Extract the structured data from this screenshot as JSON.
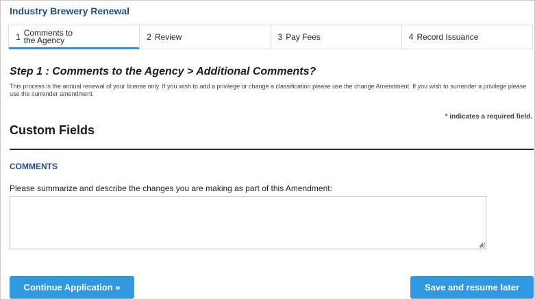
{
  "record": {
    "title": "Industry Brewery Renewal"
  },
  "steps": [
    {
      "num": "1",
      "label": "Comments to the Agency",
      "active": true
    },
    {
      "num": "2",
      "label": "Review",
      "active": false
    },
    {
      "num": "3",
      "label": "Pay Fees",
      "active": false
    },
    {
      "num": "4",
      "label": "Record Issuance",
      "active": false
    }
  ],
  "page": {
    "heading": "Step 1 : Comments to the Agency > Additional Comments?",
    "description": "This process is the annual renewal of your license only.  If you wish to add a privilege or change a classification please use the change Amendment.  If you wish to surrender a privilege please use the surrender amendment.",
    "required_star": "*",
    "required_text": " indicates a required field."
  },
  "section": {
    "title": "Custom Fields",
    "subsection": "COMMENTS",
    "field_label": "Please summarize and describe the changes you are making as part of this Amendment:",
    "field_value": ""
  },
  "buttons": {
    "continue": "Continue Application »",
    "save": "Save and resume later"
  }
}
